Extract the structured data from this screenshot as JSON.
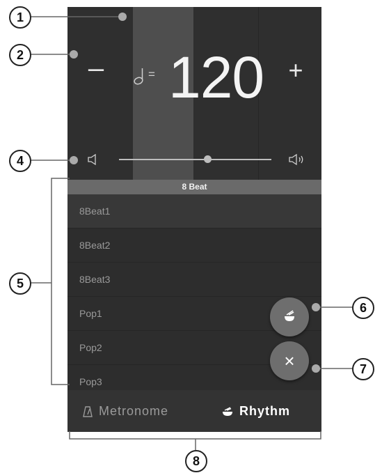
{
  "tempo": {
    "minus_label": "–",
    "plus_label": "+",
    "note_equals": "=",
    "value": "120"
  },
  "volume": {
    "level": 0.58
  },
  "category": {
    "name": "8 Beat"
  },
  "rhythms": [
    {
      "label": "8Beat1",
      "selected": true
    },
    {
      "label": "8Beat2"
    },
    {
      "label": "8Beat3"
    },
    {
      "label": "Pop1"
    },
    {
      "label": "Pop2"
    },
    {
      "label": "Pop3"
    }
  ],
  "fab": {
    "close_label": "×"
  },
  "nav": {
    "metronome_label": "Metronome",
    "rhythm_label": "Rhythm"
  },
  "callouts": [
    "1",
    "2",
    "4",
    "5",
    "6",
    "7",
    "8"
  ],
  "colors": {
    "panel": "#2d2d2d",
    "active_beat": "#4e4e4e",
    "header": "#6a6a6a",
    "fab": "#6e6e6e"
  }
}
